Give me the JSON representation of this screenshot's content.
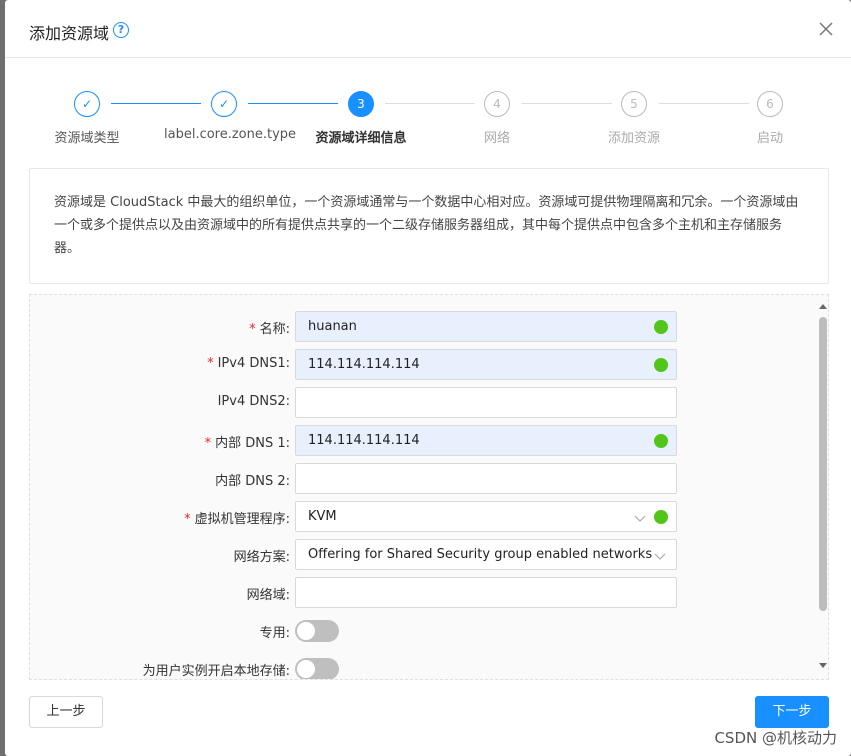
{
  "dialog": {
    "title": "添加资源域",
    "help_icon": "question-circle-icon",
    "close_icon": "close-icon"
  },
  "steps": [
    {
      "number": "1",
      "label": "资源域类型",
      "state": "done"
    },
    {
      "number": "2",
      "label": "label.core.zone.type",
      "state": "done"
    },
    {
      "number": "3",
      "label": "资源域详细信息",
      "state": "active"
    },
    {
      "number": "4",
      "label": "网络",
      "state": "pending"
    },
    {
      "number": "5",
      "label": "添加资源",
      "state": "pending"
    },
    {
      "number": "6",
      "label": "启动",
      "state": "pending"
    }
  ],
  "info": {
    "text": "资源域是 CloudStack 中最大的组织单位，一个资源域通常与一个数据中心相对应。资源域可提供物理隔离和冗余。一个资源域由一个或多个提供点以及由资源域中的所有提供点共享的一个二级存储服务器组成，其中每个提供点中包含多个主机和主存储服务器。"
  },
  "form": {
    "name": {
      "label": "名称",
      "required": true,
      "value": "huanan",
      "valid": true
    },
    "ipv4_dns1": {
      "label": "IPv4 DNS1",
      "required": true,
      "value": "114.114.114.114",
      "valid": true
    },
    "ipv4_dns2": {
      "label": "IPv4 DNS2",
      "required": false,
      "value": ""
    },
    "internal_dns1": {
      "label": "内部 DNS 1",
      "required": true,
      "value": "114.114.114.114",
      "valid": true
    },
    "internal_dns2": {
      "label": "内部 DNS 2",
      "required": false,
      "value": ""
    },
    "hypervisor": {
      "label": "虚拟机管理程序",
      "required": true,
      "value": "KVM",
      "valid": true
    },
    "network_offering": {
      "label": "网络方案",
      "value": "Offering for Shared Security group enabled networks"
    },
    "network_domain": {
      "label": "网络域",
      "value": ""
    },
    "dedicated": {
      "label": "专用",
      "checked": false
    },
    "local_storage": {
      "label": "为用户实例开启本地存储",
      "checked": false
    }
  },
  "footer": {
    "prev_label": "上一步",
    "next_label": "下一步"
  },
  "watermark": "CSDN @机核动力",
  "colors": {
    "primary": "#1890ff",
    "success": "#52c41a",
    "required": "#f5222d"
  }
}
